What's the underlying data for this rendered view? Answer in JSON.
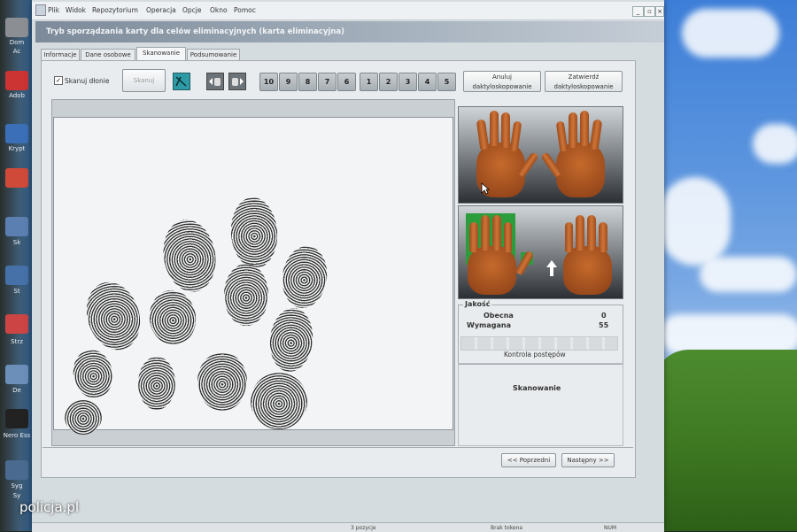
{
  "menu": [
    "Plik",
    "Widok",
    "Repozytorium",
    "Operacja",
    "Opcje",
    "Okno",
    "Pomoc"
  ],
  "window_buttons": [
    "_",
    "▫",
    "×"
  ],
  "title": "Tryb sporządzania karty dla celów eliminacyjnych (karta eliminacyjna)",
  "tabs": [
    {
      "label": "Informacje",
      "active": false
    },
    {
      "label": "Dane osobowe",
      "active": false
    },
    {
      "label": "Skanowanie",
      "active": true
    },
    {
      "label": "Podsumowanie",
      "active": false
    }
  ],
  "toolbar": {
    "scan_palms_checked": true,
    "scan_palms_label": "Skanuj dłonie",
    "scan_button": "Skanuj",
    "finger_buttons": [
      "10",
      "9",
      "8",
      "7",
      "6",
      "1",
      "2",
      "3",
      "4",
      "5"
    ],
    "cancel_button": "Anuluj\ndaktyloskopowanie",
    "confirm_button": "Zatwierdź\ndaktyloskopowanie"
  },
  "quality": {
    "legend": "Jakość",
    "current_label": "Obecna",
    "current_value": "0",
    "required_label": "Wymagana",
    "required_value": "55",
    "progress_label": "Kontrola postępów",
    "status": "Skanowanie"
  },
  "nav": {
    "prev": "<< Poprzedni",
    "next": "Następny >>"
  },
  "statusbar": [
    "3 pozycje",
    "Brak tokena",
    "NUM"
  ],
  "desktop_labels": [
    "Dom",
    "Ac",
    "Adob",
    "Krypt",
    "Sk",
    "St",
    "Strz",
    "De",
    "Nero Ess",
    "Syg",
    "Sy"
  ],
  "watermark": "policja.pl"
}
